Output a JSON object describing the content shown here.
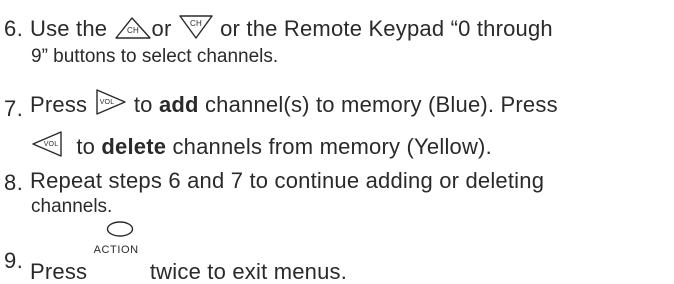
{
  "steps": [
    {
      "number": "6.",
      "line1": [
        "Use the",
        "or",
        "or the Remote Keypad “0 through"
      ],
      "line2": "9” buttons to select channels.",
      "icons": [
        "ch-up-icon",
        "ch-down-icon"
      ]
    },
    {
      "number": "7.",
      "line1": [
        "Press",
        "to",
        "add",
        "channel(s) to memory (Blue). Press"
      ],
      "line2": [
        "to",
        "delete",
        "channels from memory (Yellow)."
      ],
      "icons": [
        "vol-right-icon",
        "vol-left-icon"
      ]
    },
    {
      "number": "8.",
      "line1": "Repeat steps 6 and 7 to continue adding or deleting",
      "line2": "channels."
    },
    {
      "number": "9.",
      "line1": [
        "Press",
        "twice to exit menus."
      ],
      "button_label": "ACTION",
      "icons": [
        "action-button-icon"
      ]
    }
  ]
}
